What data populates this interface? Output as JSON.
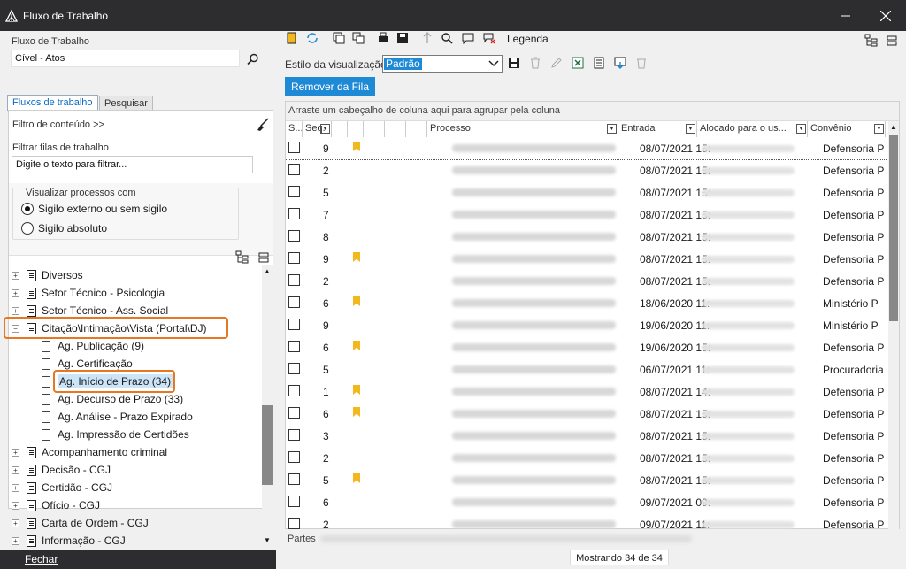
{
  "window": {
    "title": "Fluxo de Trabalho"
  },
  "left": {
    "workflow_label": "Fluxo de Trabalho",
    "workflow_value": "Cível - Atos",
    "tabs": [
      "Fluxos de trabalho",
      "Pesquisar"
    ],
    "content_filter": "Filtro de conteúdo >>",
    "filter_queues_label": "Filtrar filas de trabalho",
    "filter_placeholder": "Digite o texto para filtrar...",
    "view_group_label": "Visualizar processos com",
    "radio_external": "Sigilo externo ou sem sigilo",
    "radio_absolute": "Sigilo absoluto",
    "close_button": "Fechar"
  },
  "tree": [
    {
      "label": "Diversos",
      "level": 0
    },
    {
      "label": "Setor Técnico - Psicologia",
      "level": 0
    },
    {
      "label": "Setor Técnico - Ass. Social",
      "level": 0
    },
    {
      "label": "Citação\\Intimação\\Vista (Portal\\DJ)",
      "level": 0,
      "expanded": true,
      "highlight": true
    },
    {
      "label": "Ag. Publicação (9)",
      "level": 1
    },
    {
      "label": "Ag. Certificação",
      "level": 1
    },
    {
      "label": "Ag. Início de Prazo (34)",
      "level": 1,
      "selected": true,
      "highlight": true
    },
    {
      "label": "Ag. Decurso de Prazo (33)",
      "level": 1
    },
    {
      "label": "Ag. Análise - Prazo Expirado",
      "level": 1
    },
    {
      "label": "Ag. Impressão de Certidões",
      "level": 1
    },
    {
      "label": "Acompanhamento criminal",
      "level": 0
    },
    {
      "label": "Decisão - CGJ",
      "level": 0
    },
    {
      "label": "Certidão - CGJ",
      "level": 0
    },
    {
      "label": "Ofício - CGJ",
      "level": 0
    },
    {
      "label": "Carta de Ordem - CGJ",
      "level": 0
    },
    {
      "label": "Informação - CGJ",
      "level": 0
    }
  ],
  "toolbar": {
    "legend": "Legenda",
    "view_style_label": "Estilo da visualização",
    "view_style_value": "Padrão",
    "remove_button": "Remover da Fila"
  },
  "grid": {
    "group_hint": "Arraste um cabeçalho de coluna aqui para agrupar pela coluna",
    "columns": [
      "S...",
      "Seq.",
      "",
      "",
      "",
      "",
      "",
      "Processo",
      "Entrada",
      "Alocado para o us...",
      "Convênio"
    ],
    "rows": [
      {
        "seq": "9",
        "flag": true,
        "entrada": "08/07/2021 15:",
        "convenio": "Defensoria P"
      },
      {
        "seq": "2",
        "flag": false,
        "entrada": "08/07/2021 15:",
        "convenio": "Defensoria P"
      },
      {
        "seq": "5",
        "flag": false,
        "entrada": "08/07/2021 15:",
        "convenio": "Defensoria P"
      },
      {
        "seq": "7",
        "flag": false,
        "entrada": "08/07/2021 15:",
        "convenio": "Defensoria P"
      },
      {
        "seq": "8",
        "flag": false,
        "entrada": "08/07/2021 15:",
        "convenio": "Defensoria P"
      },
      {
        "seq": "9",
        "flag": true,
        "entrada": "08/07/2021 15:",
        "convenio": "Defensoria P"
      },
      {
        "seq": "2",
        "flag": false,
        "entrada": "08/07/2021 15:",
        "convenio": "Defensoria P"
      },
      {
        "seq": "6",
        "flag": true,
        "entrada": "18/06/2020 11:",
        "convenio": "Ministério P"
      },
      {
        "seq": "9",
        "flag": false,
        "entrada": "19/06/2020 11:",
        "convenio": "Ministério P"
      },
      {
        "seq": "6",
        "flag": true,
        "entrada": "19/06/2020 15:",
        "convenio": "Defensoria P"
      },
      {
        "seq": "5",
        "flag": false,
        "entrada": "06/07/2021 11:",
        "convenio": "Procuradoria"
      },
      {
        "seq": "1",
        "flag": true,
        "entrada": "08/07/2021 14:",
        "convenio": "Defensoria P"
      },
      {
        "seq": "6",
        "flag": true,
        "entrada": "08/07/2021 15:",
        "convenio": "Defensoria P"
      },
      {
        "seq": "3",
        "flag": false,
        "entrada": "08/07/2021 15:",
        "convenio": "Defensoria P"
      },
      {
        "seq": "2",
        "flag": false,
        "entrada": "08/07/2021 15:",
        "convenio": "Defensoria P"
      },
      {
        "seq": "5",
        "flag": true,
        "entrada": "08/07/2021 15:",
        "convenio": "Defensoria P"
      },
      {
        "seq": "6",
        "flag": false,
        "entrada": "09/07/2021 09:",
        "convenio": "Defensoria P"
      },
      {
        "seq": "2",
        "flag": false,
        "entrada": "09/07/2021 11:",
        "convenio": "Defensoria P"
      }
    ],
    "parts_label": "Partes",
    "status": "Mostrando 34 de 34"
  },
  "colors": {
    "titlebar": "#2d2d30",
    "highlight": "#e87722",
    "selection": "#cce4f7",
    "accent": "#1e8ad6",
    "flag": "#f2b81e"
  }
}
